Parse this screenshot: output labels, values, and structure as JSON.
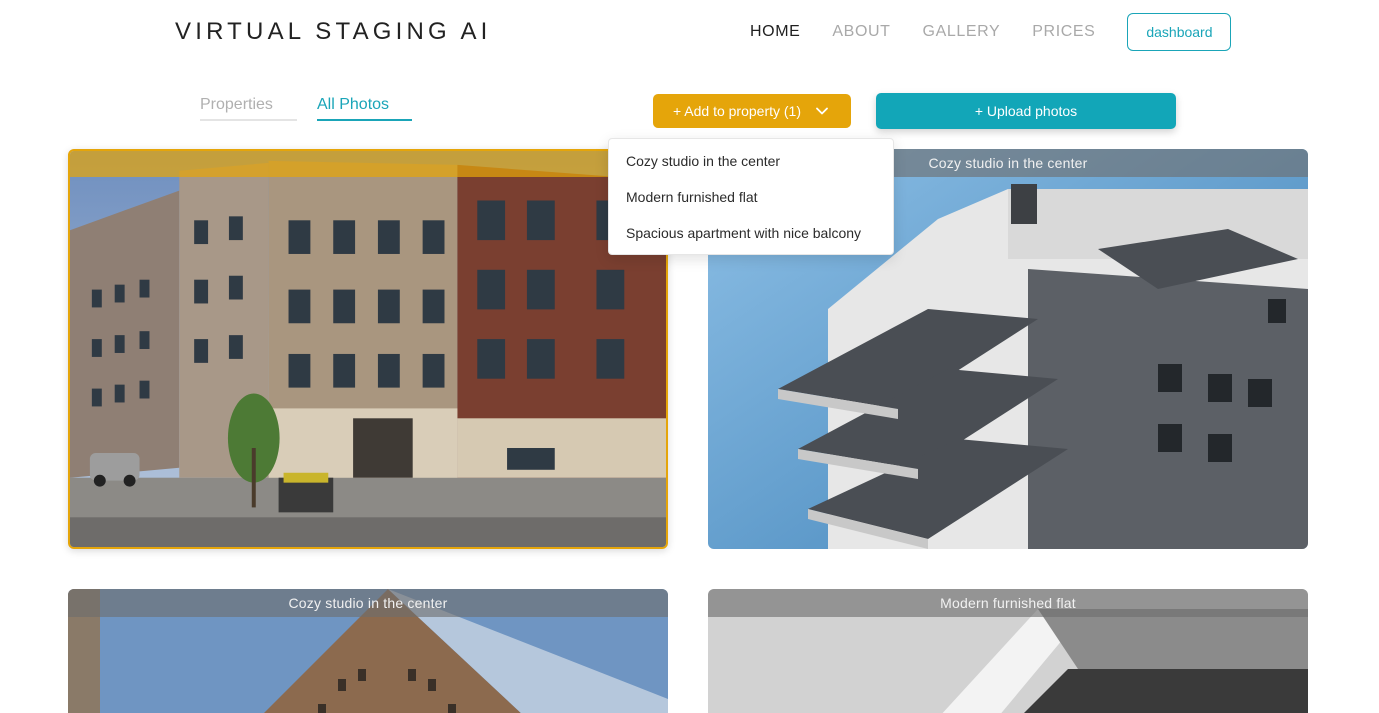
{
  "header": {
    "logo": "VIRTUAL STAGING AI",
    "nav": [
      "HOME",
      "ABOUT",
      "GALLERY",
      "PRICES"
    ],
    "dashboard_label": "dashboard"
  },
  "tabs": [
    "Properties",
    "All Photos"
  ],
  "toolbar": {
    "add_to_property_label": "+ Add to property (1)",
    "upload_label": "+ Upload photos"
  },
  "dropdown": {
    "items": [
      "Cozy studio in the center",
      "Modern furnished flat",
      "Spacious apartment with nice balcony"
    ]
  },
  "photos": [
    {
      "caption": "",
      "selected": true
    },
    {
      "caption": "Cozy studio in the center",
      "selected": false
    },
    {
      "caption": "Cozy studio in the center",
      "selected": false
    },
    {
      "caption": "Modern furnished flat",
      "selected": false
    }
  ],
  "colors": {
    "accent_teal": "#12a6b8",
    "accent_amber": "#e5a50a"
  }
}
